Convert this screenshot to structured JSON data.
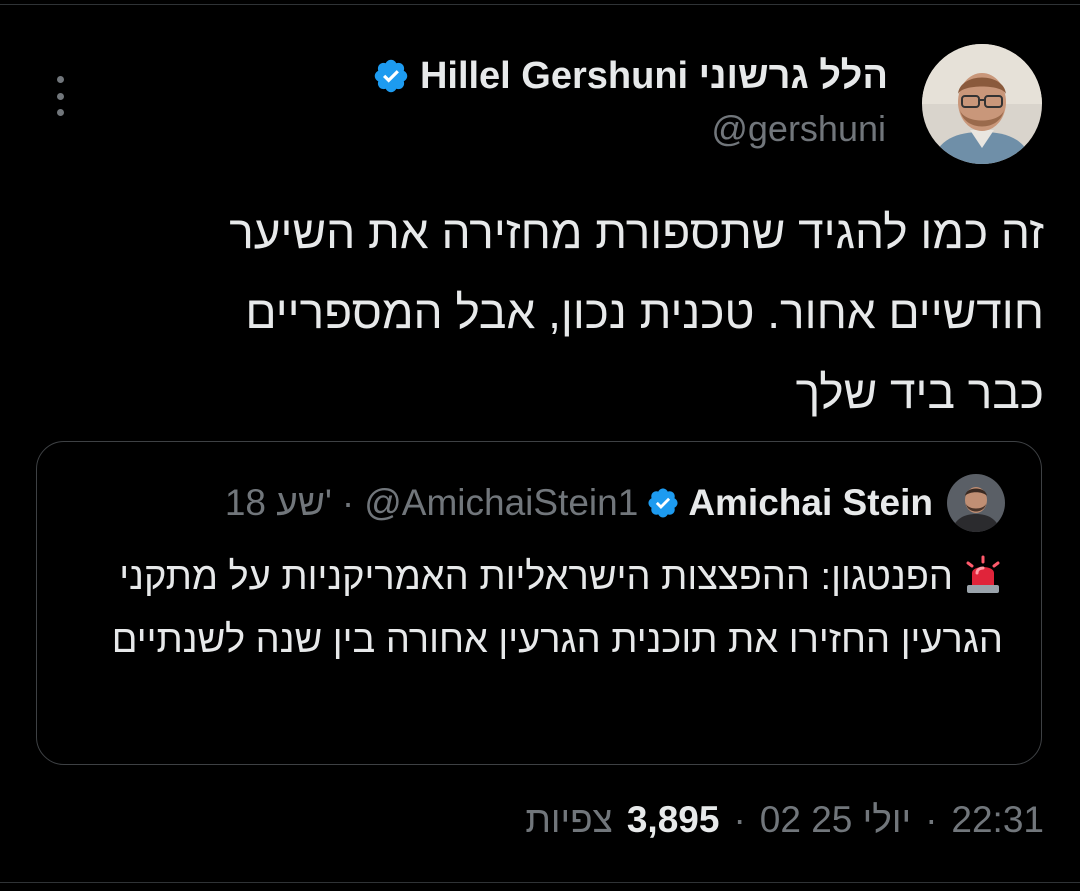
{
  "tweet": {
    "author": {
      "display_name": "הלל גרשוני Hillel Gershuni",
      "handle": "@gershuni",
      "verified_color": "#1d9bf0"
    },
    "text": "זה כמו להגיד שתספורת מחזירה את השיער\nחודשיים אחור. טכנית נכון, אבל המספריים\nכבר ביד שלך",
    "quote": {
      "author_name": "Amichai Stein",
      "handle": "@AmichaiStein1",
      "separator": "·",
      "time": "18 שע'",
      "emoji_icon": "police-siren-icon",
      "text": "הפנטגון: ההפצצות הישראליות האמריקניות על מתקני הגרעין החזירו את תוכנית הגרעין אחורה בין שנה לשנתיים"
    },
    "footer": {
      "time": "22:31",
      "date": "02 יולי 25",
      "separator": "·",
      "views_count": "3,895",
      "views_label": "צפיות"
    }
  },
  "colors": {
    "background": "#000000",
    "text_primary": "#e7e9ea",
    "text_secondary": "#71767b",
    "border": "#3e4144",
    "accent": "#1d9bf0"
  }
}
